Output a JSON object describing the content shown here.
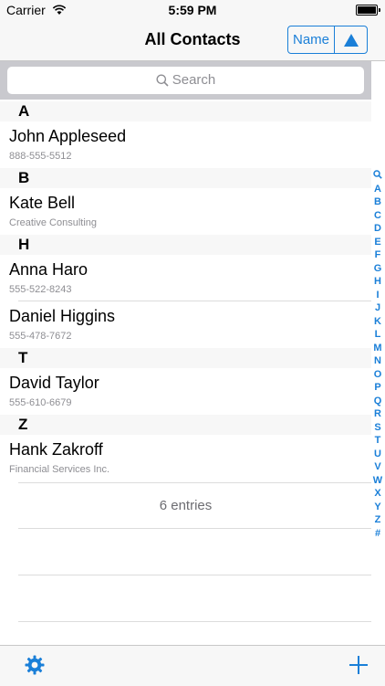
{
  "status_bar": {
    "carrier": "Carrier",
    "time": "5:59 PM"
  },
  "nav": {
    "title": "All Contacts",
    "sort_label": "Name",
    "sort_direction_icon": "triangle-up-icon"
  },
  "search": {
    "placeholder": "Search"
  },
  "sections": [
    {
      "letter": "A",
      "contacts": [
        {
          "name": "John Appleseed",
          "detail": "888-555-5512"
        }
      ]
    },
    {
      "letter": "B",
      "contacts": [
        {
          "name": "Kate Bell",
          "detail": "Creative Consulting"
        }
      ]
    },
    {
      "letter": "H",
      "contacts": [
        {
          "name": "Anna Haro",
          "detail": "555-522-8243"
        },
        {
          "name": "Daniel Higgins",
          "detail": "555-478-7672"
        }
      ]
    },
    {
      "letter": "T",
      "contacts": [
        {
          "name": "David Taylor",
          "detail": "555-610-6679"
        }
      ]
    },
    {
      "letter": "Z",
      "contacts": [
        {
          "name": "Hank Zakroff",
          "detail": "Financial Services Inc."
        }
      ]
    }
  ],
  "footer": {
    "entries_text": "6 entries"
  },
  "index_letters": [
    "A",
    "B",
    "C",
    "D",
    "E",
    "F",
    "G",
    "H",
    "I",
    "J",
    "K",
    "L",
    "M",
    "N",
    "O",
    "P",
    "Q",
    "R",
    "S",
    "T",
    "U",
    "V",
    "W",
    "X",
    "Y",
    "Z",
    "#"
  ],
  "toolbar": {
    "left_icon": "gear-icon",
    "right_icon": "plus-icon"
  },
  "colors": {
    "accent": "#1a7fd8",
    "section_bg": "#f7f7f7",
    "secondary_text": "#8e8e93"
  }
}
